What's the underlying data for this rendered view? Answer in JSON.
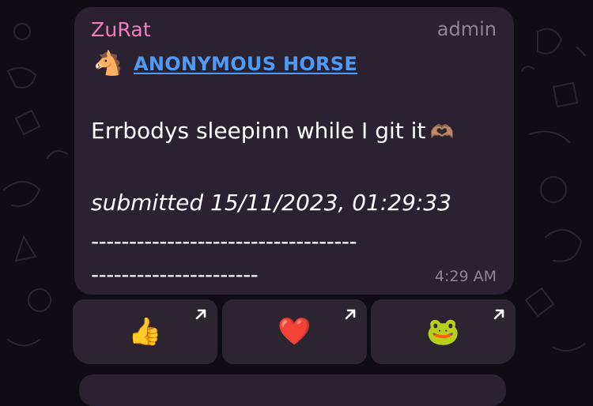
{
  "message": {
    "sender": "ZuRat",
    "role": "admin",
    "author_emoji": "🐴",
    "author_name": "ANONYMOUS HORSE",
    "text": "Errbodys sleepinn while I git it",
    "text_emoji": "🫶🏽",
    "submitted": "submitted 15/11/2023, 01:29:33",
    "dashes_line1": "-----------------------------------",
    "dashes_line2": "----------------------",
    "time": "4:29 AM"
  },
  "reactions": [
    {
      "emoji": "👍",
      "icon": "arrow-up-right-icon"
    },
    {
      "emoji": "❤️",
      "icon": "arrow-up-right-icon"
    },
    {
      "emoji": "🐸",
      "icon": "arrow-up-right-icon"
    }
  ],
  "colors": {
    "background": "#0f0d13",
    "bubble": "#2b2231",
    "sender": "#f07cc4",
    "link": "#4f9af5",
    "meta": "#8d8596",
    "text": "#ffffff"
  }
}
